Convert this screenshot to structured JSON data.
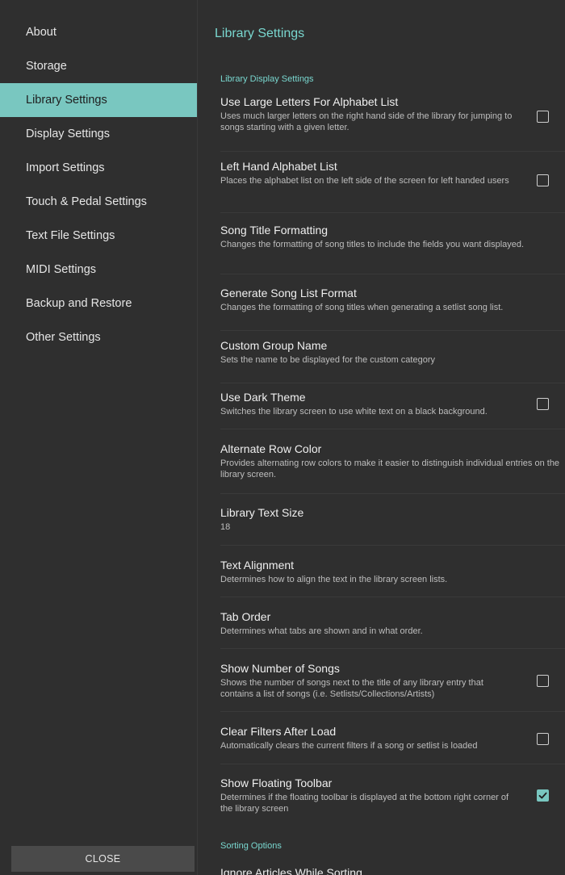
{
  "sidebar": {
    "items": [
      {
        "label": "About"
      },
      {
        "label": "Storage"
      },
      {
        "label": "Library Settings"
      },
      {
        "label": "Display Settings"
      },
      {
        "label": "Import Settings"
      },
      {
        "label": "Touch & Pedal Settings"
      },
      {
        "label": "Text File Settings"
      },
      {
        "label": "MIDI Settings"
      },
      {
        "label": "Backup and Restore"
      },
      {
        "label": "Other Settings"
      }
    ],
    "active_item": "Library Settings",
    "close_label": "CLOSE"
  },
  "main": {
    "title": "Library Settings",
    "display_section": "Library Display Settings",
    "sorting_section": "Sorting Options",
    "settings": [
      {
        "title": "Use Large Letters For Alphabet List",
        "desc": "Uses much larger letters on the right hand side of the library for jumping to songs starting with a given letter.",
        "checkbox": true,
        "checked": false
      },
      {
        "title": "Left Hand Alphabet List",
        "desc": "Places the alphabet list on the left side of the screen for left handed users",
        "checkbox": true,
        "checked": false
      },
      {
        "title": "Song Title Formatting",
        "desc": "Changes the formatting of song titles to include the fields you want displayed.",
        "checkbox": false
      },
      {
        "title": "Generate Song List Format",
        "desc": "Changes the formatting of song titles when generating a setlist song list.",
        "checkbox": false
      },
      {
        "title": "Custom Group Name",
        "desc": "Sets the name to be displayed for the custom category",
        "checkbox": false
      },
      {
        "title": "Use Dark Theme",
        "desc": "Switches the library screen to use white text on a black background.",
        "checkbox": true,
        "checked": false
      },
      {
        "title": "Alternate Row Color",
        "desc": "Provides alternating row colors to make it easier to distinguish individual entries on the library screen.",
        "checkbox": false
      },
      {
        "title": "Library Text Size",
        "desc": "18",
        "checkbox": false
      },
      {
        "title": "Text Alignment",
        "desc": "Determines how to align the text in the library screen lists.",
        "checkbox": false
      },
      {
        "title": "Tab Order",
        "desc": "Determines what tabs are shown and in what order.",
        "checkbox": false
      },
      {
        "title": "Show Number of Songs",
        "desc": "Shows the number of songs next to the title of any library entry that contains a list of songs (i.e. Setlists/Collections/Artists)",
        "checkbox": true,
        "checked": false
      },
      {
        "title": "Clear Filters After Load",
        "desc": "Automatically clears the current filters if a song or setlist is loaded",
        "checkbox": true,
        "checked": false
      },
      {
        "title": "Show Floating Toolbar",
        "desc": "Determines if the floating toolbar is displayed at the bottom right corner of the library screen",
        "checkbox": true,
        "checked": true
      }
    ],
    "partial_item": "Ignore Articles While Sorting"
  },
  "colors": {
    "background": "#2f2f2f",
    "accent": "#79c7c0",
    "accent_text": "#79d7cf"
  },
  "icons": {
    "checkbox_checked": "check-icon"
  }
}
